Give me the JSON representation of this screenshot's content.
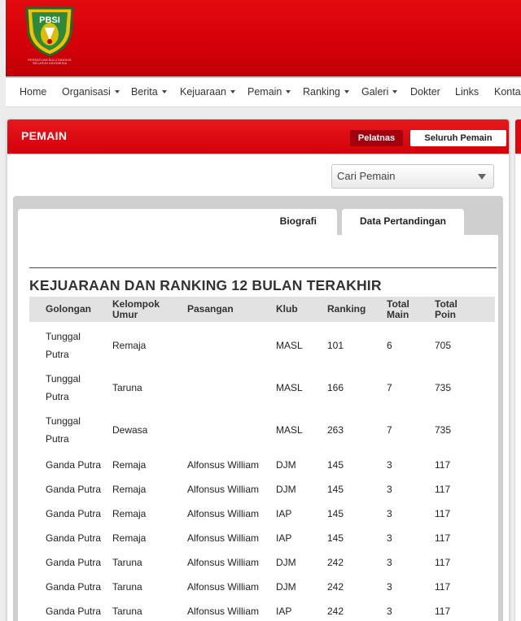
{
  "header": {
    "logo_text": "PBSI",
    "logo_caption": "PERSATUAN BULUTANGKIS SELURUH INDONESIA"
  },
  "nav": {
    "items": [
      {
        "label": "Home",
        "dropdown": false
      },
      {
        "label": "Organisasi",
        "dropdown": true
      },
      {
        "label": "Berita",
        "dropdown": true
      },
      {
        "label": "Kejuaraan",
        "dropdown": true
      },
      {
        "label": "Pemain",
        "dropdown": true
      },
      {
        "label": "Ranking",
        "dropdown": true
      },
      {
        "label": "Galeri",
        "dropdown": true
      },
      {
        "label": "Dokter",
        "dropdown": false
      },
      {
        "label": "Links",
        "dropdown": false
      },
      {
        "label": "Kontak",
        "dropdown": false
      }
    ]
  },
  "panel": {
    "title": "PEMAIN",
    "btn_pelatnas": "Pelatnas",
    "btn_seluruh": "Seluruh Pemain",
    "search_select": "Cari Pemain"
  },
  "tabs": {
    "biografi": "Biografi",
    "data": "Data Pertandingan"
  },
  "section": {
    "title": "KEJUARAAN DAN RANKING 12 BULAN TERAKHIR"
  },
  "table": {
    "headers": {
      "golongan": "Golongan",
      "kelompok_1": "Kelompok",
      "kelompok_2": "Umur",
      "pasangan": "Pasangan",
      "klub": "Klub",
      "ranking": "Ranking",
      "main_1": "Total",
      "main_2": "Main",
      "poin_1": "Total",
      "poin_2": "Poin"
    },
    "rows": [
      {
        "golongan_1": "Tunggal",
        "golongan_2": "Putra",
        "kelompok": "Remaja",
        "pasangan": "",
        "klub": "MASL",
        "ranking": "101",
        "main": "6",
        "poin": "705"
      },
      {
        "golongan_1": "Tunggal",
        "golongan_2": "Putra",
        "kelompok": "Taruna",
        "pasangan": "",
        "klub": "MASL",
        "ranking": "166",
        "main": "7",
        "poin": "735"
      },
      {
        "golongan_1": "Tunggal",
        "golongan_2": "Putra",
        "kelompok": "Dewasa",
        "pasangan": "",
        "klub": "MASL",
        "ranking": "263",
        "main": "7",
        "poin": "735"
      },
      {
        "golongan_1": "Ganda Putra",
        "golongan_2": "",
        "kelompok": "Remaja",
        "pasangan": "Alfonsus William",
        "klub": "DJM",
        "ranking": "145",
        "main": "3",
        "poin": "117"
      },
      {
        "golongan_1": "Ganda Putra",
        "golongan_2": "",
        "kelompok": "Remaja",
        "pasangan": "Alfonsus William",
        "klub": "DJM",
        "ranking": "145",
        "main": "3",
        "poin": "117"
      },
      {
        "golongan_1": "Ganda Putra",
        "golongan_2": "",
        "kelompok": "Remaja",
        "pasangan": "Alfonsus William",
        "klub": "IAP",
        "ranking": "145",
        "main": "3",
        "poin": "117"
      },
      {
        "golongan_1": "Ganda Putra",
        "golongan_2": "",
        "kelompok": "Remaja",
        "pasangan": "Alfonsus William",
        "klub": "IAP",
        "ranking": "145",
        "main": "3",
        "poin": "117"
      },
      {
        "golongan_1": "Ganda Putra",
        "golongan_2": "",
        "kelompok": "Taruna",
        "pasangan": "Alfonsus William",
        "klub": "DJM",
        "ranking": "242",
        "main": "3",
        "poin": "117"
      },
      {
        "golongan_1": "Ganda Putra",
        "golongan_2": "",
        "kelompok": "Taruna",
        "pasangan": "Alfonsus William",
        "klub": "DJM",
        "ranking": "242",
        "main": "3",
        "poin": "117"
      },
      {
        "golongan_1": "Ganda Putra",
        "golongan_2": "",
        "kelompok": "Taruna",
        "pasangan": "Alfonsus William",
        "klub": "IAP",
        "ranking": "242",
        "main": "3",
        "poin": "117"
      }
    ]
  }
}
